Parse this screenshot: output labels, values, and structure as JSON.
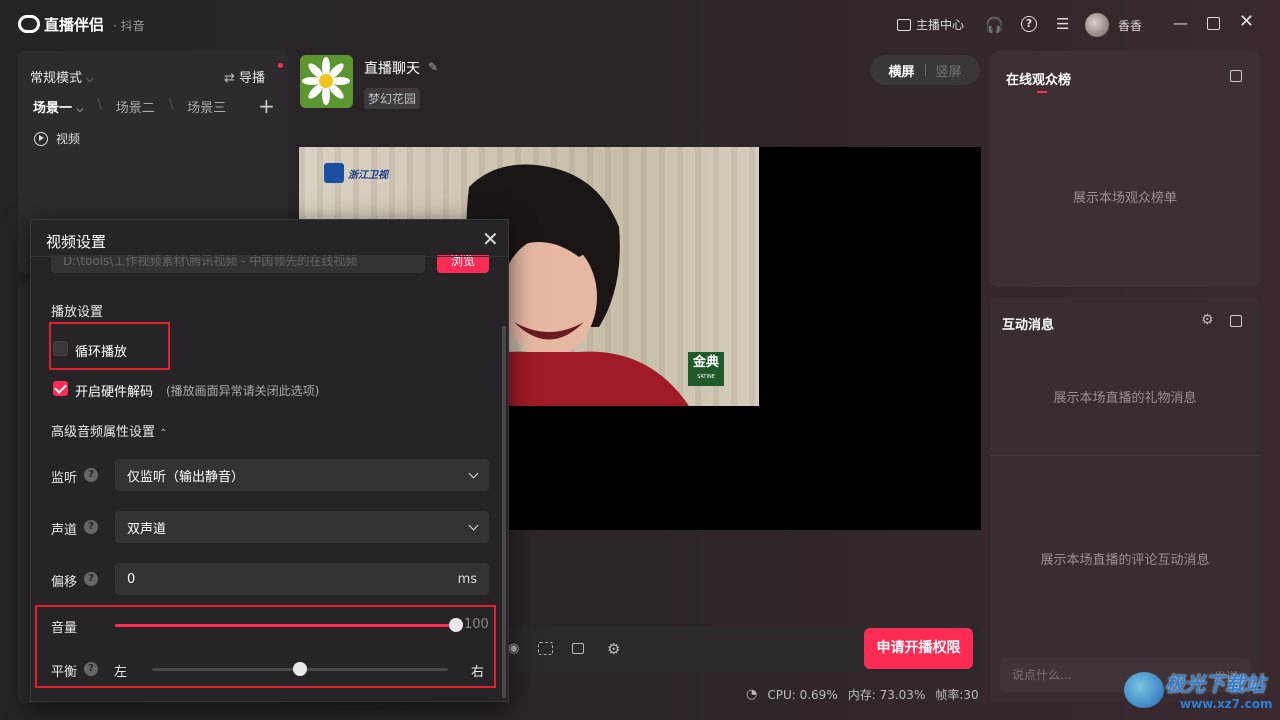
{
  "titlebar": {
    "app_title": "直播伴侣",
    "app_sub": "· 抖音",
    "anchor_center": "主播中心",
    "username": "香香"
  },
  "left_panel": {
    "mode": "常规模式",
    "guide": "导播",
    "scenes": [
      "场景一",
      "场景二",
      "场景三"
    ],
    "source": "视频"
  },
  "stream": {
    "title": "直播聊天",
    "tag": "梦幻花园",
    "orientation": {
      "landscape": "横屏",
      "portrait": "竖屏"
    },
    "video_logo_text": "浙江卫视",
    "brand_logo_text": "金典",
    "brand_logo_sub": "SATINE"
  },
  "controls": {
    "apply_button": "申请开播权限",
    "status": {
      "cpu": "CPU: 0.69%",
      "memory": "内存: 73.03%",
      "fps": "帧率:30"
    }
  },
  "right_panel": {
    "audience_title": "在线观众榜",
    "audience_empty": "展示本场观众榜单",
    "interact_title": "互动消息",
    "gift_empty": "展示本场直播的礼物消息",
    "comment_empty": "展示本场直播的评论互动消息",
    "chat_placeholder": "说点什么...",
    "send_label": "发送"
  },
  "watermark": {
    "text": "极光下载站",
    "url": "www.xz7.com"
  },
  "dialog": {
    "title": "视频设置",
    "path": "D:\\tools\\工作视频素材\\腾讯视频 - 中国领先的在线视频",
    "browse": "浏览",
    "playback_section": "播放设置",
    "loop_label": "循环播放",
    "loop_checked": false,
    "hw_decode_label": "开启硬件解码",
    "hw_decode_hint": "(播放画面异常请关闭此选项)",
    "hw_decode_checked": true,
    "advanced_section": "高级音频属性设置",
    "monitor_label": "监听",
    "monitor_value": "仅监听（输出静音）",
    "channel_label": "声道",
    "channel_value": "双声道",
    "offset_label": "偏移",
    "offset_value": "0",
    "offset_unit": "ms",
    "volume_label": "音量",
    "volume_value": "100",
    "volume_fraction": 1.0,
    "balance_label": "平衡",
    "balance_left": "左",
    "balance_right": "右",
    "balance_fraction": 0.5
  },
  "colors": {
    "accent": "#fe2c55",
    "highlight_box": "#e0202a"
  }
}
